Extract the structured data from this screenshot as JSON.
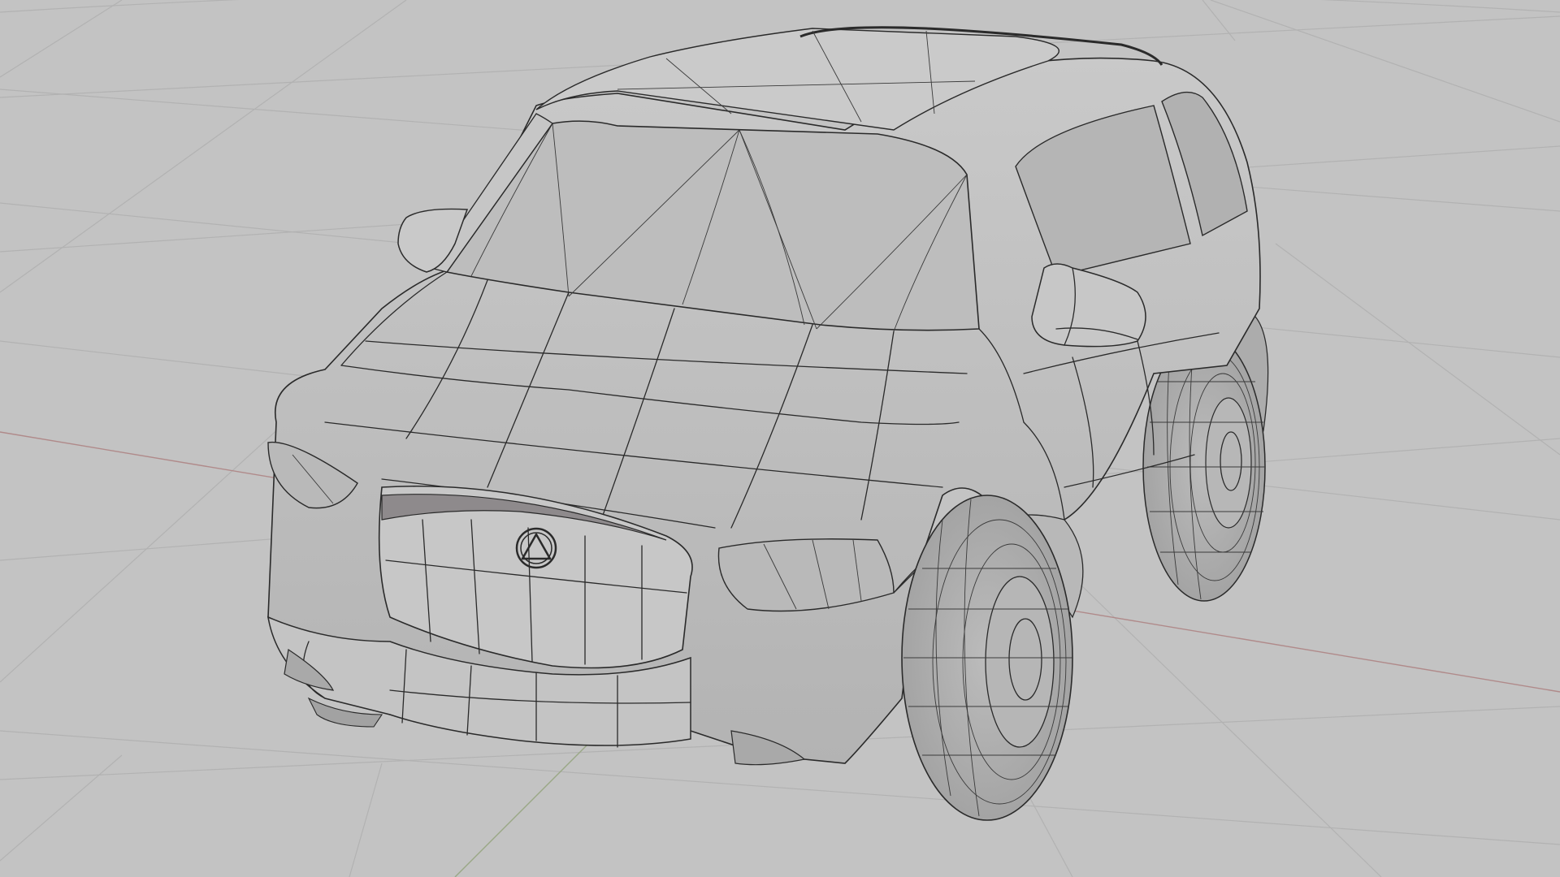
{
  "viewport": {
    "background_color": "#c3c3c3",
    "grid_color": "#b2b2b2",
    "x_axis_color": "#b08a8a",
    "y_axis_color": "#9aa886",
    "mesh_color": "#bfbfbf",
    "wire_color": "#2a2a2a"
  },
  "model": {
    "object": "suv",
    "badge_icon": "triangle-in-circle-logo-icon"
  }
}
